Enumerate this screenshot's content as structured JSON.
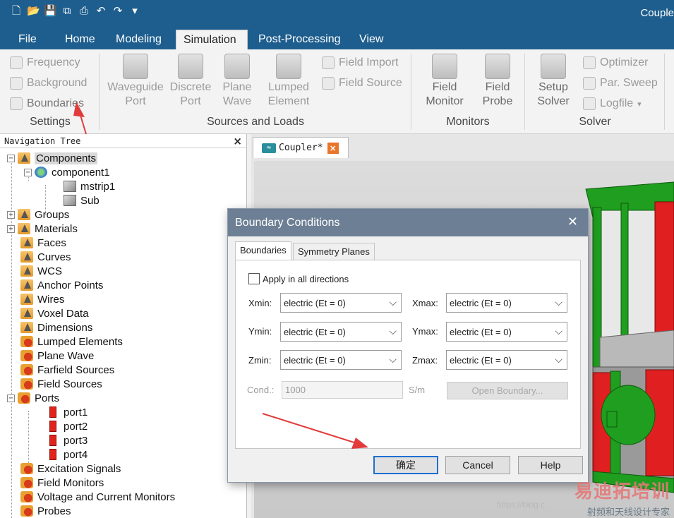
{
  "app": {
    "title": "Couple"
  },
  "qat": [
    "new-icon",
    "open-icon",
    "save-icon",
    "save-all-icon",
    "print-icon",
    "undo-icon",
    "redo-icon",
    "customize-icon"
  ],
  "tabs": [
    "File",
    "Home",
    "Modeling",
    "Simulation",
    "Post-Processing",
    "View"
  ],
  "active_tab": "Simulation",
  "ribbon": {
    "settings": {
      "label": "Settings",
      "items": [
        "Frequency",
        "Background",
        "Boundaries"
      ]
    },
    "sources": {
      "label": "Sources and Loads",
      "big": [
        [
          "Waveguide",
          "Port"
        ],
        [
          "Discrete",
          "Port"
        ],
        [
          "Plane",
          "Wave"
        ],
        [
          "Lumped",
          "Element"
        ]
      ],
      "small": [
        "Field Import",
        "Field Source"
      ]
    },
    "monitors": {
      "label": "Monitors",
      "big": [
        [
          "Field",
          "Monitor"
        ],
        [
          "Field",
          "Probe"
        ]
      ]
    },
    "solver": {
      "label": "Solver",
      "big": [
        [
          "Setup",
          "Solver"
        ]
      ],
      "small": [
        "Optimizer",
        "Par. Sweep",
        "Logfile"
      ]
    }
  },
  "nav": {
    "title": "Navigation Tree",
    "close": "×",
    "items": [
      "Components",
      "component1",
      "mstrip1",
      "Sub",
      "Groups",
      "Materials",
      "Faces",
      "Curves",
      "WCS",
      "Anchor Points",
      "Wires",
      "Voxel Data",
      "Dimensions",
      "Lumped Elements",
      "Plane Wave",
      "Farfield Sources",
      "Field Sources",
      "Ports",
      "port1",
      "port2",
      "port3",
      "port4",
      "Excitation Signals",
      "Field Monitors",
      "Voltage and Current Monitors",
      "Probes"
    ]
  },
  "doc": {
    "tab_label": "Coupler*",
    "tab_close": "×"
  },
  "dialog": {
    "title": "Boundary Conditions",
    "close": "✕",
    "tabs": [
      "Boundaries",
      "Symmetry Planes"
    ],
    "apply_all": "Apply in all directions",
    "labels": {
      "xmin": "Xmin:",
      "xmax": "Xmax:",
      "ymin": "Ymin:",
      "ymax": "Ymax:",
      "zmin": "Zmin:",
      "zmax": "Zmax:"
    },
    "values": {
      "xmin": "electric (Et = 0)",
      "xmax": "electric (Et = 0)",
      "ymin": "electric (Et = 0)",
      "ymax": "electric (Et = 0)",
      "zmin": "electric (Et = 0)",
      "zmax": "electric (Et = 0)"
    },
    "cond_label": "Cond.:",
    "cond_value": "1000",
    "cond_unit": "S/m",
    "open_boundary": "Open Boundary...",
    "ok": "确定",
    "cancel": "Cancel",
    "help": "Help"
  },
  "watermark": {
    "brand": "易迪拓培训",
    "sub": "射频和天线设计专家",
    "url": "https://blog.c"
  },
  "colors": {
    "titlebar": "#1e5e8e",
    "dialog_title": "#6c7f94",
    "arrow": "#e23b3b",
    "model_green": "#22a022",
    "model_red": "#e02020"
  }
}
